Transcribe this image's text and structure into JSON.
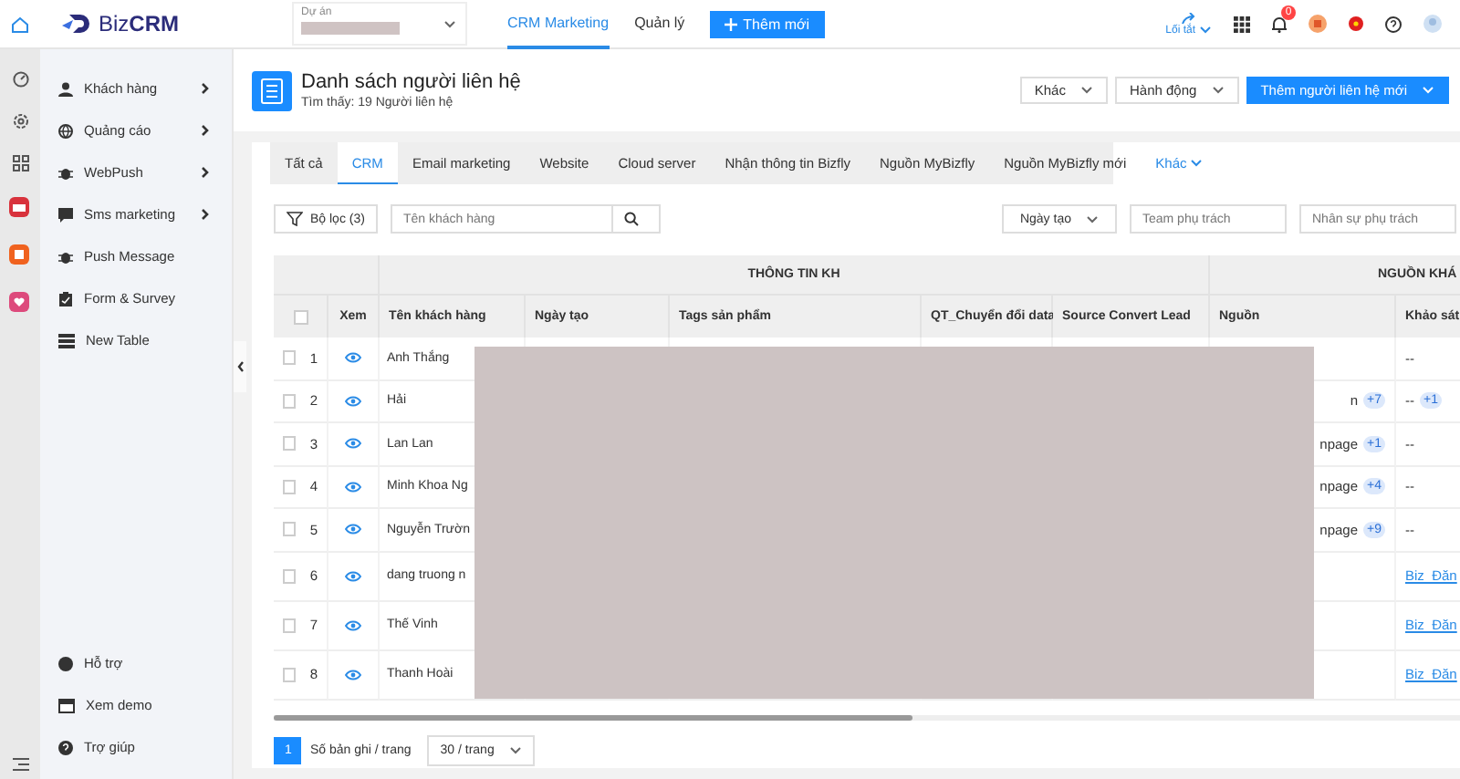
{
  "top_bar": {
    "logo": {
      "part_1": "Biz",
      "part_2": "CRM"
    },
    "project_field": {
      "label": "Dự án"
    },
    "nav": [
      {
        "label": "CRM Marketing",
        "selected": true
      },
      {
        "label": "Quản lý",
        "selected": false
      }
    ],
    "add_button": "Thêm mới",
    "shortcut": "Lối tắt",
    "notification_count": "0"
  },
  "sidebar": {
    "items": [
      {
        "label": "Khách hàng",
        "expandable": true
      },
      {
        "label": "Quảng cáo",
        "expandable": true
      },
      {
        "label": "WebPush",
        "expandable": true
      },
      {
        "label": "Sms marketing",
        "expandable": true
      },
      {
        "label": "Push Message",
        "expandable": false
      },
      {
        "label": "Form & Survey",
        "expandable": false
      },
      {
        "label": "New Table",
        "expandable": false
      }
    ],
    "footer_items": [
      {
        "label": "Hỗ trợ"
      },
      {
        "label": "Xem demo"
      },
      {
        "label": "Trợ giúp"
      }
    ]
  },
  "page_header": {
    "title": "Danh sách người liên hệ",
    "subtitle": "Tìm thấy: 19 Người liên hệ",
    "buttons": [
      {
        "label": "Khác",
        "kind": "dropdown"
      },
      {
        "label": "Hành động",
        "kind": "dropdown"
      },
      {
        "label": "Thêm người liên hệ mới",
        "kind": "primary"
      }
    ]
  },
  "tabs": [
    {
      "label": "Tất cả",
      "selected": false
    },
    {
      "label": "CRM",
      "selected": true
    },
    {
      "label": "Email marketing",
      "selected": false
    },
    {
      "label": "Website",
      "selected": false
    },
    {
      "label": "Cloud server",
      "selected": false
    },
    {
      "label": "Nhận thông tin Bizfly",
      "selected": false
    },
    {
      "label": "Nguồn MyBizfly",
      "selected": false
    },
    {
      "label": "Nguồn MyBizfly mới",
      "selected": false
    }
  ],
  "more_tab": "Khác",
  "filters": {
    "filter_button": "Bộ lọc (3)",
    "search_placeholder": "Tên khách hàng",
    "date_dropdown": "Ngày tạo",
    "team_placeholder": "Team phụ trách",
    "staff_placeholder": "Nhân sự phụ trách"
  },
  "table": {
    "group_headers": [
      "THÔNG TIN KH",
      "NGUỒN KHÁ"
    ],
    "select_all_checked": false,
    "columns": [
      "Xem",
      "Tên khách hàng",
      "Ngày tạo",
      "Tags sản phẩm",
      "QT_Chuyển đổi data",
      "Source Convert Lead",
      "Nguồn",
      "Khảo sát"
    ],
    "rows": [
      {
        "index": "1",
        "name": "Anh Thắng",
        "checked": false,
        "survey": "--"
      },
      {
        "index": "2",
        "name": "Hải",
        "checked": false,
        "source": "n",
        "source_more": "+7",
        "survey": "--",
        "survey_more": "+1"
      },
      {
        "index": "3",
        "name": "Lan Lan",
        "checked": false,
        "source": "npage",
        "source_more": "+1",
        "survey": "--"
      },
      {
        "index": "4",
        "name": "Minh Khoa Ng",
        "checked": false,
        "source": "npage",
        "source_more": "+4",
        "survey": "--"
      },
      {
        "index": "5",
        "name": "Nguyễn Trườn",
        "checked": false,
        "source": "npage",
        "source_more": "+9",
        "survey": "--"
      },
      {
        "index": "6",
        "name": "dang truong n",
        "checked": false,
        "survey_link": "Biz_Đăn"
      },
      {
        "index": "7",
        "name": "Thế Vinh",
        "checked": false,
        "survey_link": "Biz_Đăn"
      },
      {
        "index": "8",
        "name": "Thanh Hoài",
        "checked": false,
        "survey_link": "Biz_Đăn"
      }
    ]
  },
  "pagination": {
    "current_page": "1",
    "per_page_label": "Số bản ghi / trang",
    "page_size": "30 / trang"
  }
}
